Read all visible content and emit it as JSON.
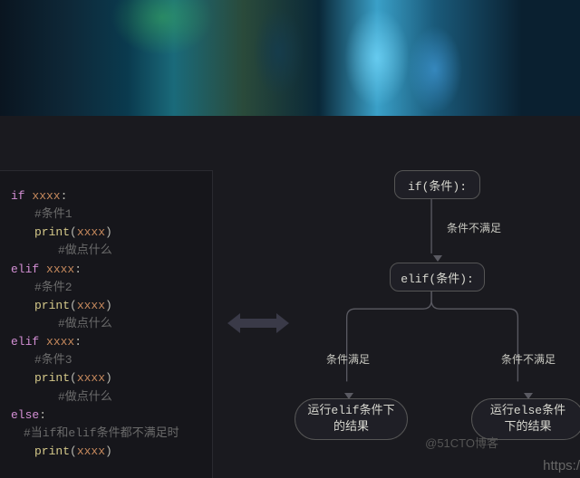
{
  "code": {
    "l1_kw": "if ",
    "l1_var": "xxxx",
    "l1_colon": ":",
    "l2_comment": "#条件1",
    "l3_fn": "print",
    "l3_open": "(",
    "l3_arg": "xxxx",
    "l3_close": ")",
    "l4_comment": "#做点什么",
    "l5_kw": "elif ",
    "l5_var": "xxxx",
    "l5_colon": ":",
    "l6_comment": "#条件2",
    "l7_fn": "print",
    "l7_open": "(",
    "l7_arg": "xxxx",
    "l7_close": ")",
    "l8_comment": "#做点什么",
    "l9_kw": "elif ",
    "l9_var": "xxxx",
    "l9_colon": ":",
    "l10_comment": "#条件3",
    "l11_fn": "print",
    "l11_open": "(",
    "l11_arg": "xxxx",
    "l11_close": ")",
    "l12_comment": "#做点什么",
    "l13_kw": "else",
    "l13_colon": ":",
    "l14_comment": "#当if和elif条件都不满足时",
    "l15_fn": "print",
    "l15_open": "(",
    "l15_arg": "xxxx",
    "l15_close": ")"
  },
  "flow": {
    "node_if": "if(条件):",
    "node_elif": "elif(条件):",
    "node_result_elif_l1": "运行elif条件下",
    "node_result_elif_l2": "的结果",
    "node_result_else_l1": "运行else条件",
    "node_result_else_l2": "下的结果",
    "label_not_satisfied_1": "条件不满足",
    "label_satisfied": "条件满足",
    "label_not_satisfied_2": "条件不满足"
  },
  "watermark1": "@51CTO博客",
  "watermark2": "https:/"
}
